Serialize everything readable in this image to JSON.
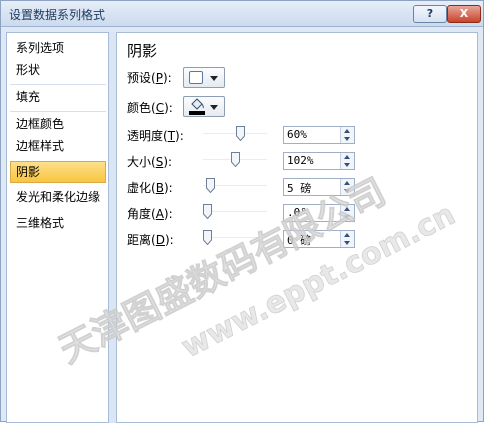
{
  "window": {
    "title": "设置数据系列格式",
    "help_label": "?",
    "close_label": "X"
  },
  "nav": {
    "items": [
      {
        "label": "系列选项",
        "selected": false
      },
      {
        "label": "形状",
        "selected": false
      },
      {
        "label": "填充",
        "selected": false
      },
      {
        "label": "边框颜色",
        "selected": false
      },
      {
        "label": "边框样式",
        "selected": false
      },
      {
        "label": "阴影",
        "selected": true
      },
      {
        "label": "发光和柔化边缘",
        "selected": false
      },
      {
        "label": "三维格式",
        "selected": false
      }
    ]
  },
  "panel": {
    "title": "阴影",
    "preset": {
      "label": "预设",
      "key": "P"
    },
    "color": {
      "label": "颜色",
      "key": "C"
    },
    "transparency": {
      "label": "透明度",
      "key": "T",
      "value": "60%",
      "level": 0.6
    },
    "size": {
      "label": "大小",
      "key": "S",
      "value": "102%",
      "level": 0.51
    },
    "blur": {
      "label": "虚化",
      "key": "B",
      "value": "5 磅",
      "level": 0.05
    },
    "angle": {
      "label": "角度",
      "key": "A",
      "value": ".0°",
      "level": 0.0
    },
    "distance": {
      "label": "距离",
      "key": "D",
      "value": "0 磅",
      "level": 0.0
    }
  },
  "watermark": {
    "line1": "天津图盛数码有限公司",
    "line2": "www.eppt.com.cn"
  },
  "colors": {
    "selected_nav": "#f8c53f",
    "title_text": "#1e395b",
    "close_button": "#c9432b"
  }
}
